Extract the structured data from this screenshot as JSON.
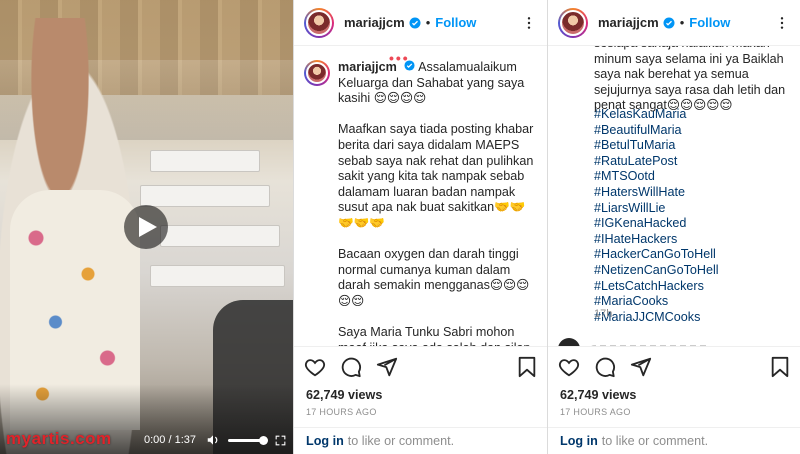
{
  "video": {
    "watermark": "myartis.com",
    "time": "0:00 / 1:37",
    "volume_level": 1.0
  },
  "post": {
    "username": "mariajjcm",
    "follow_label": "Follow",
    "caption_text": "Assalamualaikum Keluarga dan Sahabat yang saya kasihi 😌😌😌😌\n\nMaafkan saya tiada posting khabar berita dari saya didalam MAEPS sebab saya nak rehat dan pulihkan sakit yang kita tak nampak sebab dalamam luaran badan nampak susut apa nak buat sakitkan🤝🤝🤝🤝🤝\n\nBacaan oxygen dan darah tinggi normal cumanya kuman dalam darah semakin mengganas😌😌😌😌😌\n\nSaya Maria Tunku Sabri mohon maaf jika saya ada salah dan silap dengan sesiapa sahaja halalkan makan minum saya selama ini ya Baiklah saya nak berehat ya semua sejujurnya saya rasa dah letih dan penat sangat😌😌😌😌😌",
    "caption_tail": "sesiapa sahaja halalkan makan minum saya selama ini ya Baiklah saya nak berehat ya semua sejujurnya saya rasa dah letih dan penat sangat😌😌😌😌😌",
    "hashtags": [
      "#KelasKauMaria",
      "#BeautifulMaria",
      "#BetulTuMaria",
      "#RatuLatePost",
      "#MTSOotd",
      "#HatersWillHate",
      "#LiarsWillLie",
      "#IGKenaHacked",
      "#IHateHackers",
      "#HackerCanGoToHell",
      "#NetizenCanGoToHell",
      "#LetsCatchHackers",
      "#MariaCooks",
      "#MariaJJCMCooks"
    ],
    "age": "17h",
    "views": "62,749 views",
    "posted": "17 HOURS AGO",
    "login_link": "Log in",
    "login_text": "to like or comment."
  },
  "colors": {
    "accent": "#0095f6",
    "hashtag": "#00376b",
    "muted": "#8e8e8e",
    "watermark": "#e0232a"
  },
  "icons": {
    "like": "heart-icon",
    "comment": "comment-icon",
    "share": "share-icon",
    "save": "bookmark-icon",
    "more": "more-icon",
    "verified": "verified-badge-icon",
    "play": "play-icon"
  }
}
